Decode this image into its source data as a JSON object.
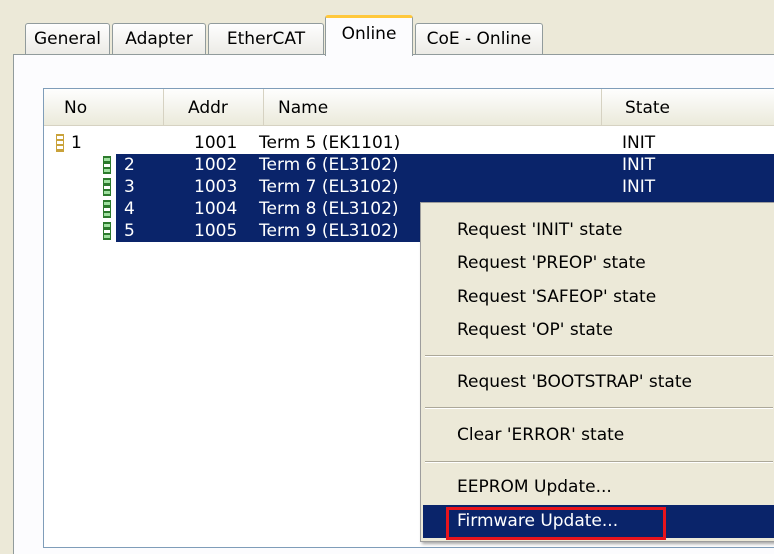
{
  "tabs": [
    {
      "label": "General"
    },
    {
      "label": "Adapter"
    },
    {
      "label": "EtherCAT"
    },
    {
      "label": "Online",
      "active": true
    },
    {
      "label": "CoE - Online"
    }
  ],
  "list": {
    "columns": {
      "no": "No",
      "addr": "Addr",
      "name": "Name",
      "state": "State"
    },
    "rows": [
      {
        "no": "1",
        "addr": "1001",
        "name": "Term 5 (EK1101)",
        "state": "INIT",
        "selected": false,
        "icon": "coupler-icon"
      },
      {
        "no": "2",
        "addr": "1002",
        "name": "Term 6 (EL3102)",
        "state": "INIT",
        "selected": true,
        "icon": "terminal-icon"
      },
      {
        "no": "3",
        "addr": "1003",
        "name": "Term 7 (EL3102)",
        "state": "INIT",
        "selected": true,
        "icon": "terminal-icon"
      },
      {
        "no": "4",
        "addr": "1004",
        "name": "Term 8 (EL3102)",
        "state": "",
        "selected": true,
        "icon": "terminal-icon"
      },
      {
        "no": "5",
        "addr": "1005",
        "name": "Term 9 (EL3102)",
        "state": "",
        "selected": true,
        "icon": "terminal-icon"
      }
    ]
  },
  "context_menu": {
    "items": [
      {
        "label": "Request 'INIT' state"
      },
      {
        "label": "Request 'PREOP' state"
      },
      {
        "label": "Request 'SAFEOP' state"
      },
      {
        "label": "Request 'OP' state"
      },
      {
        "label": "Request 'BOOTSTRAP' state"
      },
      {
        "label": "Clear 'ERROR' state"
      },
      {
        "label": "EEPROM Update..."
      },
      {
        "label": "Firmware Update...",
        "highlighted": true
      }
    ]
  },
  "colors": {
    "selection": "#0a246a",
    "highlight_box": "#e8141c",
    "active_tab_accent": "#ffc83c"
  }
}
